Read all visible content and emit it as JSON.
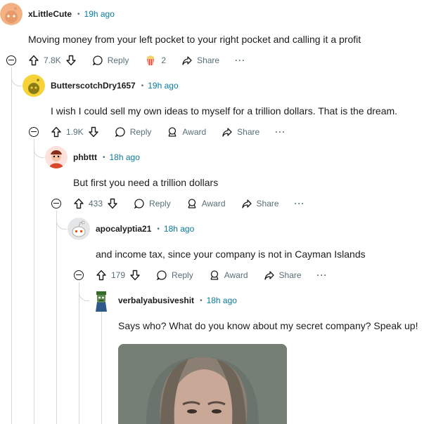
{
  "comments": [
    {
      "author": "xLittleCute",
      "time": "19h ago",
      "text": "Moving money from your left pocket to your right pocket and calling it a profit",
      "votes": "7.8K",
      "reply": "Reply",
      "award_count": "2",
      "share": "Share",
      "more": "···"
    },
    {
      "author": "ButterscotchDry1657",
      "time": "19h ago",
      "text": "I wish I could sell my own ideas to myself for a trillion dollars. That is the dream.",
      "votes": "1.9K",
      "reply": "Reply",
      "award": "Award",
      "share": "Share",
      "more": "···"
    },
    {
      "author": "phbttt",
      "time": "18h ago",
      "text": "But first you need a trillion dollars",
      "votes": "433",
      "reply": "Reply",
      "award": "Award",
      "share": "Share",
      "more": "···"
    },
    {
      "author": "apocalyptia21",
      "time": "18h ago",
      "text": "and income tax, since your company is not in Cayman Islands",
      "votes": "179",
      "reply": "Reply",
      "award": "Award",
      "share": "Share",
      "more": "···"
    },
    {
      "author": "verbalyabusiveshit",
      "time": "18h ago",
      "text": "Says who? What do you know about my secret company? Speak up!"
    }
  ],
  "colors": {
    "meta": "#576f76",
    "text": "#1c1c1c",
    "line": "#d4d7d9",
    "time": "#0a7a9e"
  }
}
